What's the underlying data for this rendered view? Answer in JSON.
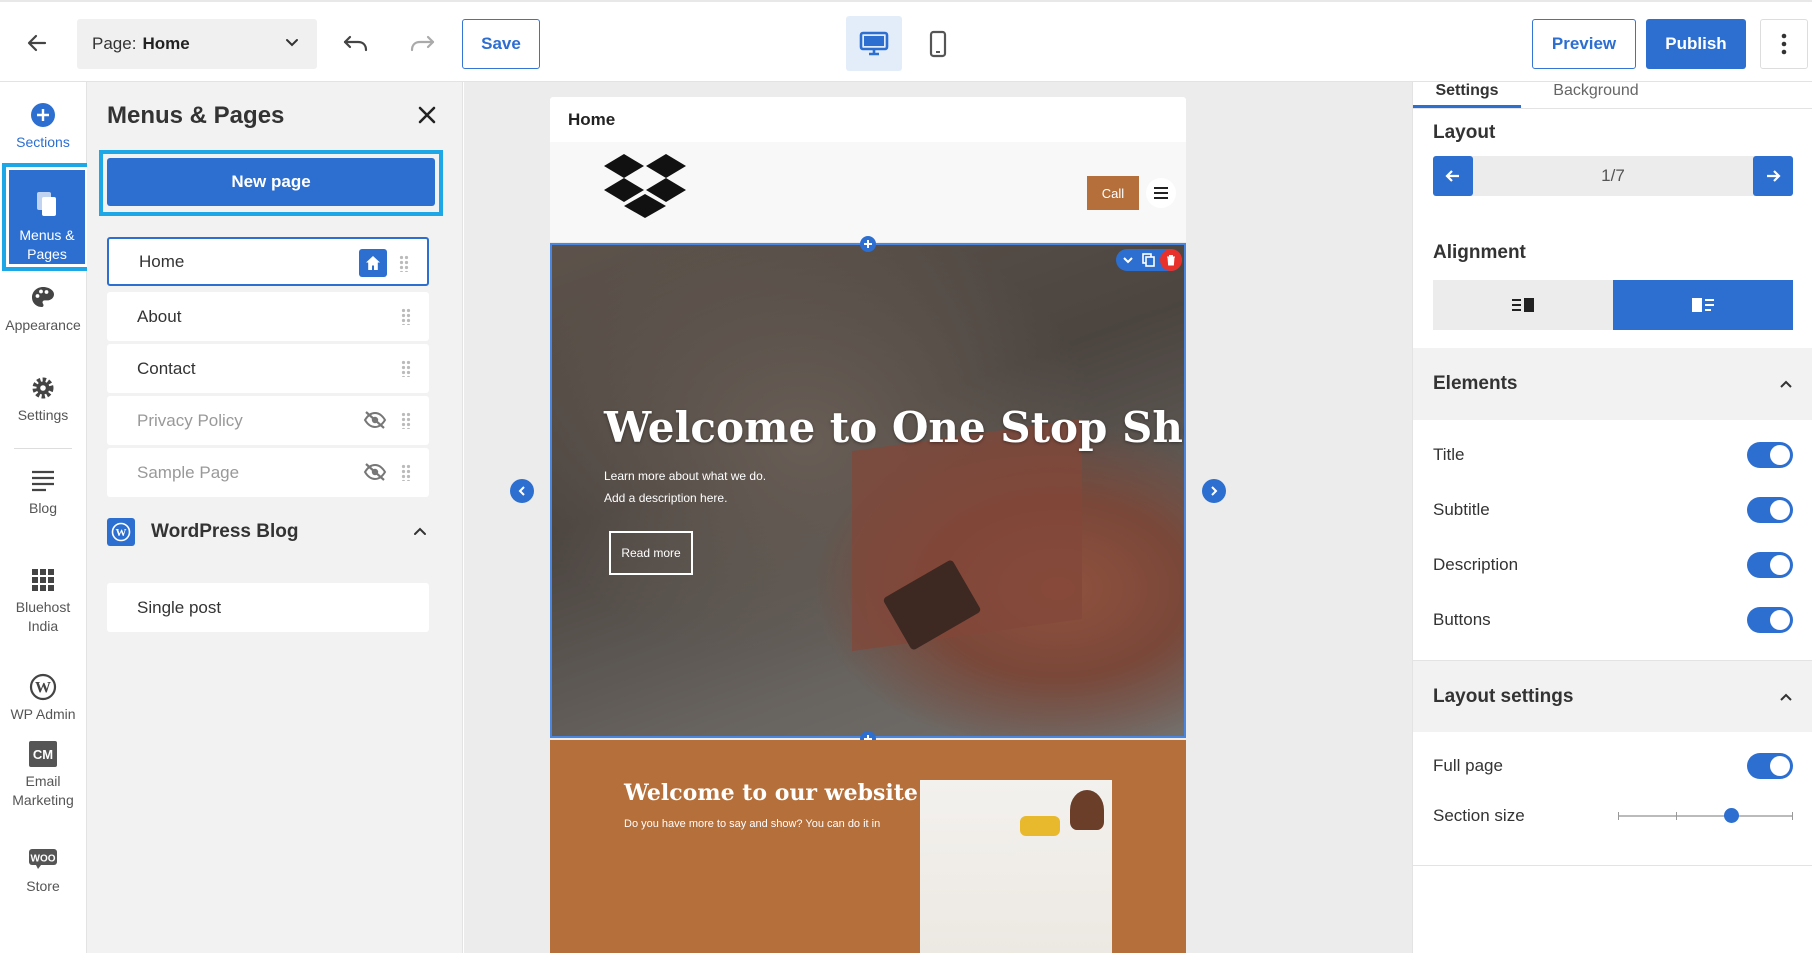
{
  "topbar": {
    "page_label": "Page:",
    "page_value": "Home",
    "save": "Save",
    "preview": "Preview",
    "publish": "Publish"
  },
  "leftnav": {
    "items": [
      {
        "label": "Sections",
        "icon": "plus-circle-icon"
      },
      {
        "label": "Menus &\nPages",
        "icon": "pages-icon"
      },
      {
        "label": "Appearance",
        "icon": "palette-icon"
      },
      {
        "label": "Settings",
        "icon": "gear-icon"
      },
      {
        "label": "Blog",
        "icon": "blog-icon"
      },
      {
        "label": "Bluehost\nIndia",
        "icon": "grid-icon"
      },
      {
        "label": "WP Admin",
        "icon": "wordpress-icon"
      },
      {
        "label": "Email\nMarketing",
        "icon": "email-marketing-icon"
      },
      {
        "label": "Store",
        "icon": "woo-icon"
      }
    ]
  },
  "menus_panel": {
    "title": "Menus & Pages",
    "new_page": "New page",
    "pages": [
      "Home",
      "About",
      "Contact",
      "Privacy Policy",
      "Sample Page"
    ],
    "blog_heading": "WordPress Blog",
    "blog_pages": [
      "Single post"
    ]
  },
  "canvas": {
    "page_title": "Home",
    "call_button": "Call",
    "hero_title": "Welcome to One Stop Shop",
    "hero_line1": "Learn more about what we do.",
    "hero_line2": "Add a description here.",
    "hero_button": "Read more",
    "section2_title": "Welcome to our website",
    "section2_text": "Do you have more to say and show? You can do it in"
  },
  "right_panel": {
    "tabs": [
      "Settings",
      "Background"
    ],
    "layout_label": "Layout",
    "layout_counter": "1/7",
    "alignment_label": "Alignment",
    "elements_heading": "Elements",
    "elements": [
      {
        "label": "Title",
        "on": true
      },
      {
        "label": "Subtitle",
        "on": true
      },
      {
        "label": "Description",
        "on": true
      },
      {
        "label": "Buttons",
        "on": true
      }
    ],
    "layout_settings_heading": "Layout settings",
    "full_page_label": "Full page",
    "full_page_on": true,
    "section_size_label": "Section size",
    "section_size_value": 0.65
  },
  "colors": {
    "accent": "#2c6fd0",
    "highlight": "#1ea7e6",
    "call_button": "#b56f3a",
    "section2_bg": "#b56f3a"
  }
}
